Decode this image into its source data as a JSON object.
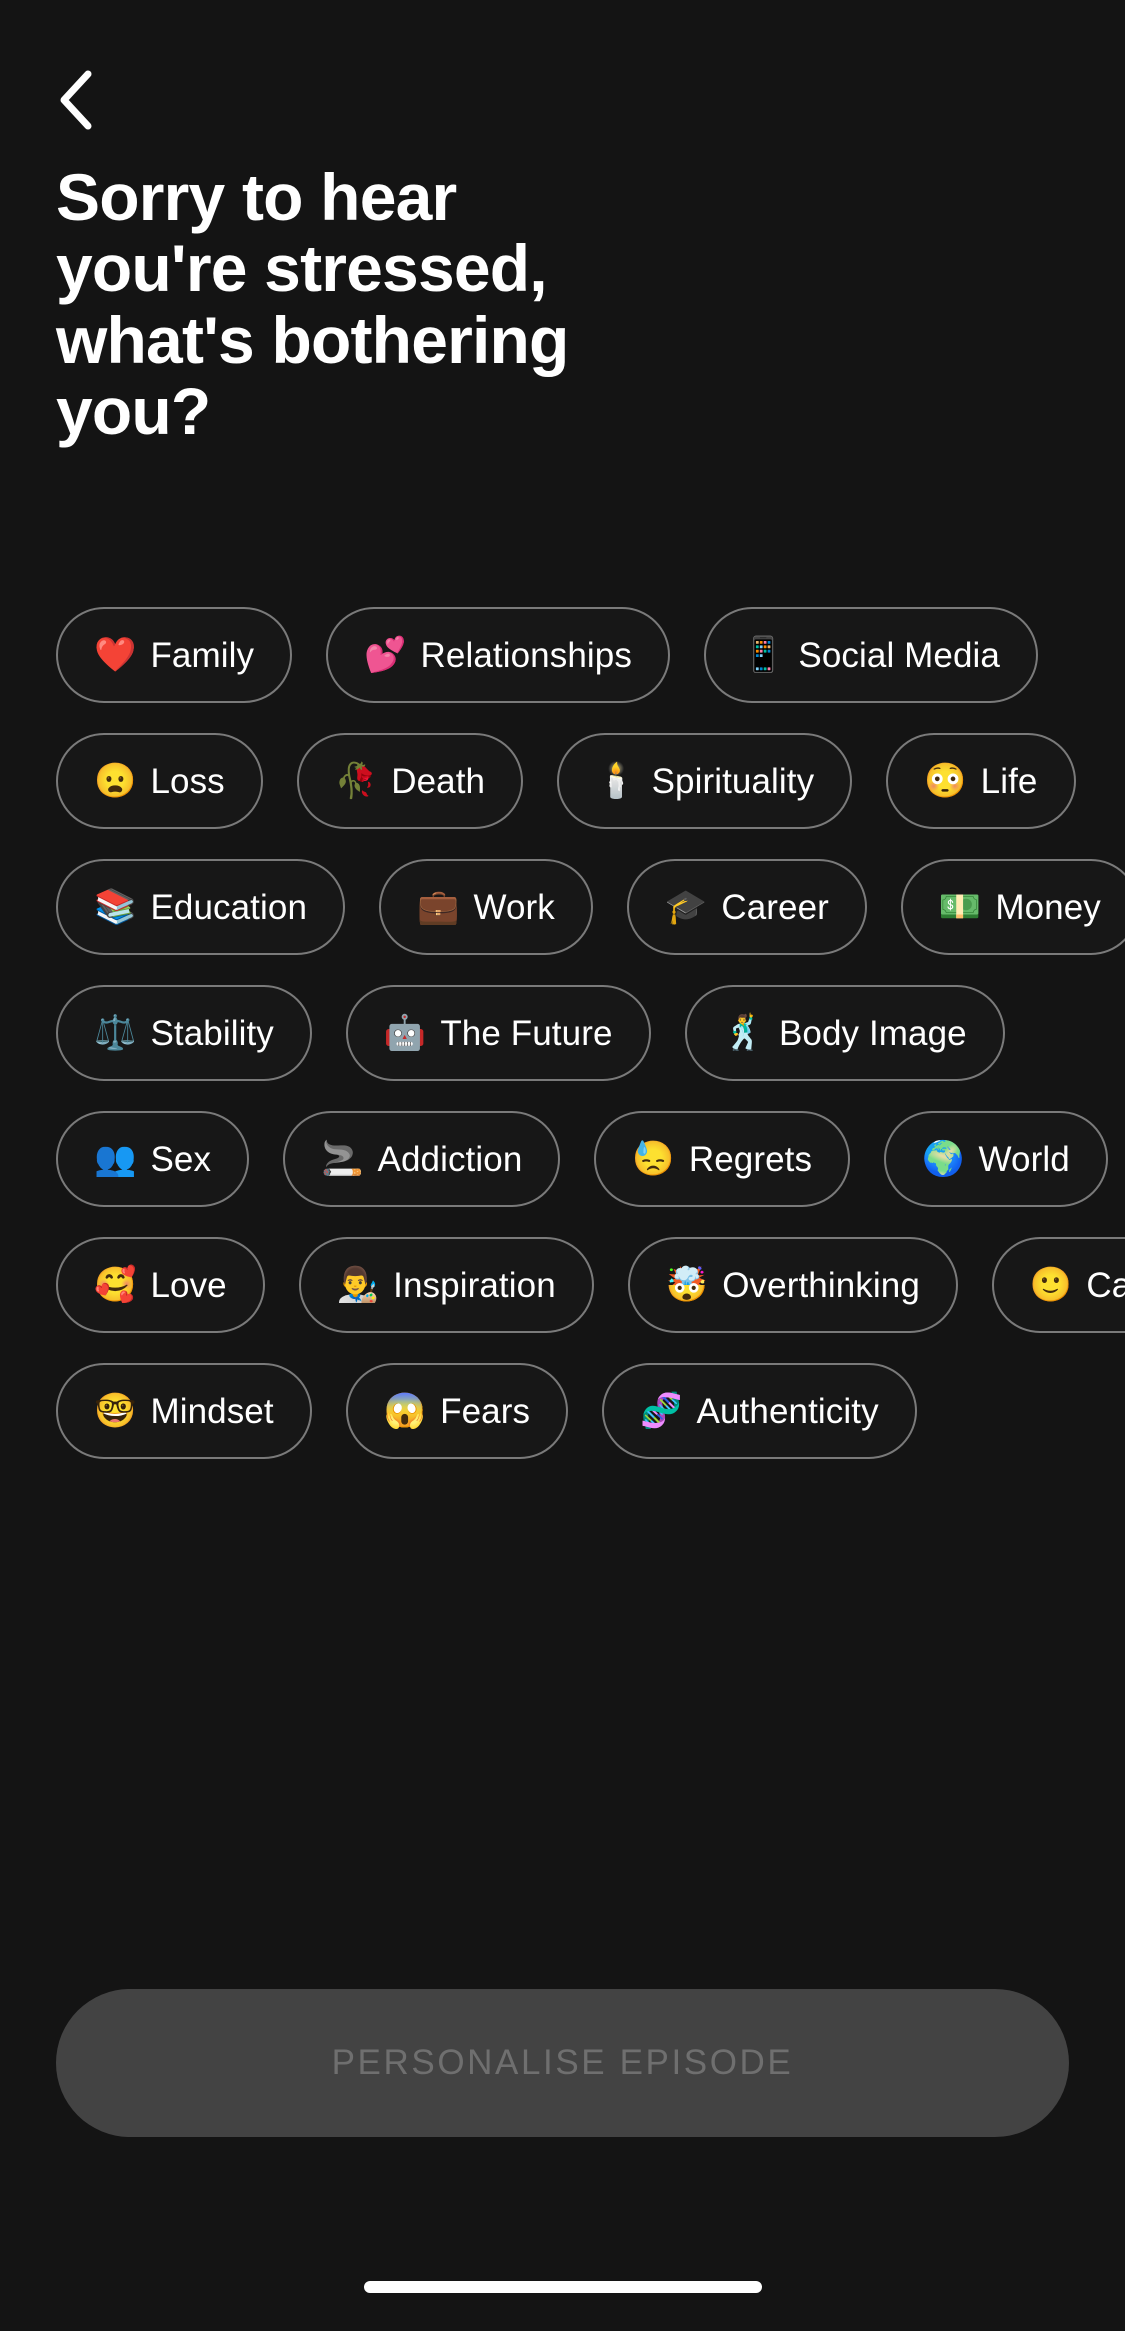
{
  "screen": {
    "name": "stress-topic-picker",
    "background_color": "#141414",
    "text_color": "#ffffff"
  },
  "nav": {
    "back_icon": "chevron-left-icon",
    "back_label": "Back"
  },
  "header": {
    "title": "Sorry to hear you're stressed, what's bothering you?"
  },
  "topics": {
    "rows": [
      [
        {
          "emoji": "❤️",
          "icon_name": "red-heart-emoji",
          "label": "Family",
          "selected": false
        },
        {
          "emoji": "💕",
          "icon_name": "two-hearts-emoji",
          "label": "Relationships",
          "selected": false
        },
        {
          "emoji": "📱",
          "icon_name": "mobile-phone-emoji",
          "label": "Social Media",
          "selected": false
        }
      ],
      [
        {
          "emoji": "😦",
          "icon_name": "frowning-face-open-mouth-emoji",
          "label": "Loss",
          "selected": false
        },
        {
          "emoji": "🥀",
          "icon_name": "wilted-flower-emoji",
          "label": "Death",
          "selected": false
        },
        {
          "emoji": "🕯️",
          "icon_name": "candle-emoji",
          "label": "Spirituality",
          "selected": false
        },
        {
          "emoji": "😳",
          "icon_name": "flushed-face-emoji",
          "label": "Life",
          "selected": false
        }
      ],
      [
        {
          "emoji": "📚",
          "icon_name": "books-emoji",
          "label": "Education",
          "selected": false
        },
        {
          "emoji": "💼",
          "icon_name": "briefcase-emoji",
          "label": "Work",
          "selected": false
        },
        {
          "emoji": "🎓",
          "icon_name": "graduation-cap-emoji",
          "label": "Career",
          "selected": false
        },
        {
          "emoji": "💵",
          "icon_name": "dollar-banknote-emoji",
          "label": "Money",
          "selected": false
        }
      ],
      [
        {
          "emoji": "⚖️",
          "icon_name": "balance-scale-emoji",
          "label": "Stability",
          "selected": false
        },
        {
          "emoji": "🤖",
          "icon_name": "robot-emoji",
          "label": "The Future",
          "selected": false
        },
        {
          "emoji": "🕺",
          "icon_name": "dancing-man-emoji",
          "label": "Body Image",
          "selected": false
        }
      ],
      [
        {
          "emoji": "👥",
          "icon_name": "busts-in-silhouette-emoji",
          "label": "Sex",
          "selected": false
        },
        {
          "emoji": "🚬",
          "icon_name": "cigarette-emoji",
          "label": "Addiction",
          "selected": false
        },
        {
          "emoji": "😓",
          "icon_name": "downcast-face-with-sweat-emoji",
          "label": "Regrets",
          "selected": false
        },
        {
          "emoji": "🌍",
          "icon_name": "globe-europe-africa-emoji",
          "label": "World",
          "selected": false
        }
      ],
      [
        {
          "emoji": "🥰",
          "icon_name": "smiling-face-with-hearts-emoji",
          "label": "Love",
          "selected": false
        },
        {
          "emoji": "👨‍🎨",
          "icon_name": "man-artist-emoji",
          "label": "Inspiration",
          "selected": false
        },
        {
          "emoji": "🤯",
          "icon_name": "exploding-head-emoji",
          "label": "Overthinking",
          "selected": false
        },
        {
          "emoji": "🙂",
          "icon_name": "slightly-smiling-face-emoji",
          "label": "Calm",
          "selected": false
        }
      ],
      [
        {
          "emoji": "🤓",
          "icon_name": "nerd-face-emoji",
          "label": "Mindset",
          "selected": false
        },
        {
          "emoji": "😱",
          "icon_name": "screaming-face-emoji",
          "label": "Fears",
          "selected": false
        },
        {
          "emoji": "🧬",
          "icon_name": "dna-emoji",
          "label": "Authenticity",
          "selected": false
        }
      ]
    ]
  },
  "cta": {
    "label": "PERSONALISE EPISODE",
    "enabled": false,
    "background_color": "#434343",
    "text_color": "#6f6f6f"
  },
  "system": {
    "home_indicator": true
  }
}
